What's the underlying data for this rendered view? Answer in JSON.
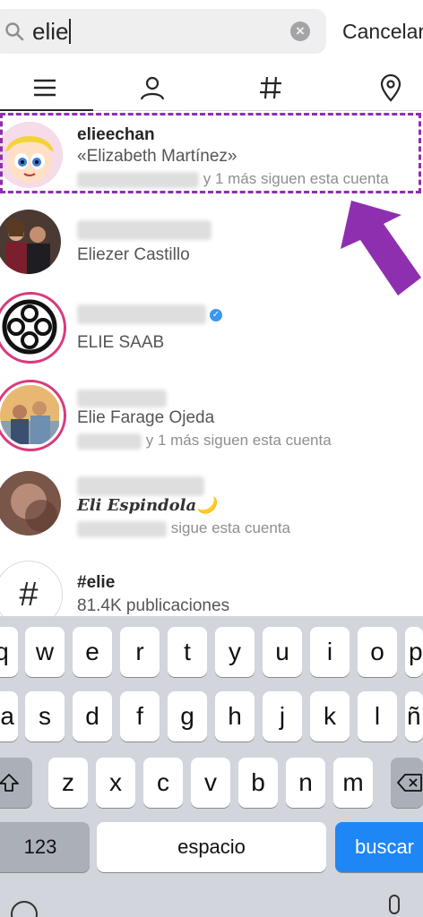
{
  "search": {
    "query": "elie",
    "cancel_label": "Cancelar"
  },
  "tabs": [
    {
      "name": "top",
      "icon": "list-icon",
      "active": true
    },
    {
      "name": "accounts",
      "icon": "person-icon"
    },
    {
      "name": "tags",
      "icon": "hashtag-icon"
    },
    {
      "name": "places",
      "icon": "location-pin-icon"
    }
  ],
  "results": [
    {
      "username": "elieechan",
      "fullname": "«Elizabeth Martínez»",
      "meta": "y 1 más siguen esta cuenta"
    },
    {
      "fullname": "Eliezer Castillo"
    },
    {
      "fullname": "ELIE SAAB",
      "verified": true
    },
    {
      "fullname": "Elie Farage Ojeda",
      "meta": "y 1 más siguen esta cuenta"
    },
    {
      "fullname": "𝑬𝒍𝒊 𝑬𝒔𝒑𝒊𝒏𝒅𝒐𝒍𝒂🌙",
      "meta": "sigue esta cuenta"
    },
    {
      "username": "#elie",
      "meta": "81.4K publicaciones",
      "icon_text": "#"
    }
  ],
  "keyboard": {
    "row1": [
      "q",
      "w",
      "e",
      "r",
      "t",
      "y",
      "u",
      "i",
      "o",
      "p"
    ],
    "row2": [
      "a",
      "s",
      "d",
      "f",
      "g",
      "h",
      "j",
      "k",
      "l",
      "ñ"
    ],
    "row3": [
      "z",
      "x",
      "c",
      "v",
      "b",
      "n",
      "m"
    ],
    "num_label": "123",
    "space_label": "espacio",
    "search_label": "buscar"
  },
  "colors": {
    "highlight": "#8e2fb0",
    "accent_blue": "#1f86f6",
    "verified": "#3897f0"
  }
}
